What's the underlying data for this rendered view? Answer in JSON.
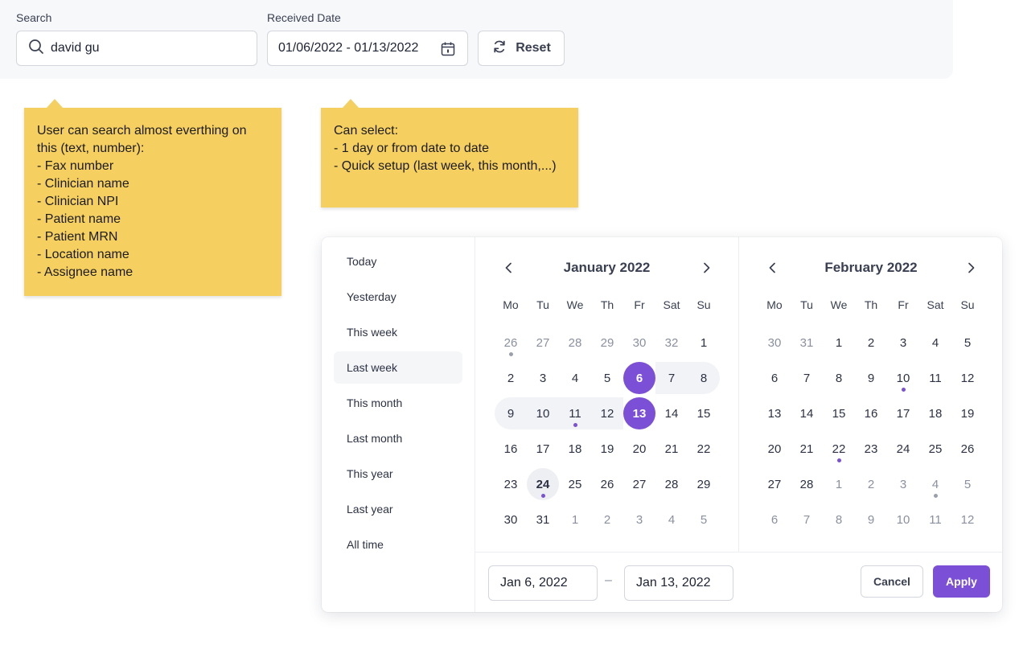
{
  "filters": {
    "search_label": "Search",
    "search_value": "david gu",
    "received_label": "Received Date",
    "date_range_value": "01/06/2022 - 01/13/2022",
    "reset_label": "Reset"
  },
  "notes": {
    "search_note": "User can search almost everthing on this (text, number):\n- Fax number\n- Clinician name\n- Clinician NPI\n- Patient name\n- Patient MRN\n- Location name\n- Assignee name",
    "date_note": "Can select:\n- 1 day or from date to date\n- Quick setup (last week, this month,...)"
  },
  "quick_ranges": [
    {
      "label": "Today"
    },
    {
      "label": "Yesterday"
    },
    {
      "label": "This week"
    },
    {
      "label": "Last week",
      "active": true
    },
    {
      "label": "This month"
    },
    {
      "label": "Last month"
    },
    {
      "label": "This year"
    },
    {
      "label": "Last year"
    },
    {
      "label": "All time"
    }
  ],
  "weekdays": [
    "Mo",
    "Tu",
    "We",
    "Th",
    "Fr",
    "Sat",
    "Su"
  ],
  "months": [
    {
      "title": "January 2022",
      "weeks": [
        [
          {
            "d": "26",
            "o": 1,
            "dot": "grey"
          },
          {
            "d": "27",
            "o": 1
          },
          {
            "d": "28",
            "o": 1
          },
          {
            "d": "29",
            "o": 1
          },
          {
            "d": "30",
            "o": 1
          },
          {
            "d": "32",
            "o": 1
          },
          {
            "d": "1"
          }
        ],
        [
          {
            "d": "2"
          },
          {
            "d": "3"
          },
          {
            "d": "4"
          },
          {
            "d": "5"
          },
          {
            "d": "6",
            "sel": 1
          },
          {
            "d": "7",
            "r": 1
          },
          {
            "d": "8",
            "r": 1,
            "re": 1
          }
        ],
        [
          {
            "d": "9",
            "r": 1,
            "rs": 1
          },
          {
            "d": "10",
            "r": 1
          },
          {
            "d": "11",
            "r": 1,
            "dot": "purple"
          },
          {
            "d": "12",
            "r": 1
          },
          {
            "d": "13",
            "sel": 1
          },
          {
            "d": "14"
          },
          {
            "d": "15"
          }
        ],
        [
          {
            "d": "16"
          },
          {
            "d": "17"
          },
          {
            "d": "18"
          },
          {
            "d": "19"
          },
          {
            "d": "20"
          },
          {
            "d": "21"
          },
          {
            "d": "22"
          }
        ],
        [
          {
            "d": "23"
          },
          {
            "d": "24",
            "today": 1,
            "dot": "purple"
          },
          {
            "d": "25"
          },
          {
            "d": "26"
          },
          {
            "d": "27"
          },
          {
            "d": "28"
          },
          {
            "d": "29"
          }
        ],
        [
          {
            "d": "30"
          },
          {
            "d": "31"
          },
          {
            "d": "1",
            "o": 1
          },
          {
            "d": "2",
            "o": 1
          },
          {
            "d": "3",
            "o": 1
          },
          {
            "d": "4",
            "o": 1
          },
          {
            "d": "5",
            "o": 1
          }
        ]
      ]
    },
    {
      "title": "February 2022",
      "weeks": [
        [
          {
            "d": "30",
            "o": 1
          },
          {
            "d": "31",
            "o": 1
          },
          {
            "d": "1"
          },
          {
            "d": "2"
          },
          {
            "d": "3"
          },
          {
            "d": "4"
          },
          {
            "d": "5"
          }
        ],
        [
          {
            "d": "6"
          },
          {
            "d": "7"
          },
          {
            "d": "8"
          },
          {
            "d": "9"
          },
          {
            "d": "10",
            "dot": "purple"
          },
          {
            "d": "11"
          },
          {
            "d": "12"
          }
        ],
        [
          {
            "d": "13"
          },
          {
            "d": "14"
          },
          {
            "d": "15"
          },
          {
            "d": "16"
          },
          {
            "d": "17"
          },
          {
            "d": "18"
          },
          {
            "d": "19"
          }
        ],
        [
          {
            "d": "20"
          },
          {
            "d": "21"
          },
          {
            "d": "22",
            "dot": "purple"
          },
          {
            "d": "23"
          },
          {
            "d": "24"
          },
          {
            "d": "25"
          },
          {
            "d": "26"
          }
        ],
        [
          {
            "d": "27"
          },
          {
            "d": "28"
          },
          {
            "d": "1",
            "o": 1
          },
          {
            "d": "2",
            "o": 1
          },
          {
            "d": "3",
            "o": 1
          },
          {
            "d": "4",
            "o": 1,
            "dot": "grey"
          },
          {
            "d": "5",
            "o": 1
          }
        ],
        [
          {
            "d": "6",
            "o": 1
          },
          {
            "d": "7",
            "o": 1
          },
          {
            "d": "8",
            "o": 1
          },
          {
            "d": "9",
            "o": 1
          },
          {
            "d": "10",
            "o": 1
          },
          {
            "d": "11",
            "o": 1
          },
          {
            "d": "12",
            "o": 1
          }
        ]
      ]
    }
  ],
  "footer": {
    "from_value": "Jan 6, 2022",
    "separator": "–",
    "to_value": "Jan 13, 2022",
    "cancel_label": "Cancel",
    "apply_label": "Apply"
  },
  "colors": {
    "accent": "#7b4fd6",
    "note_bg": "#f5cf5f"
  }
}
